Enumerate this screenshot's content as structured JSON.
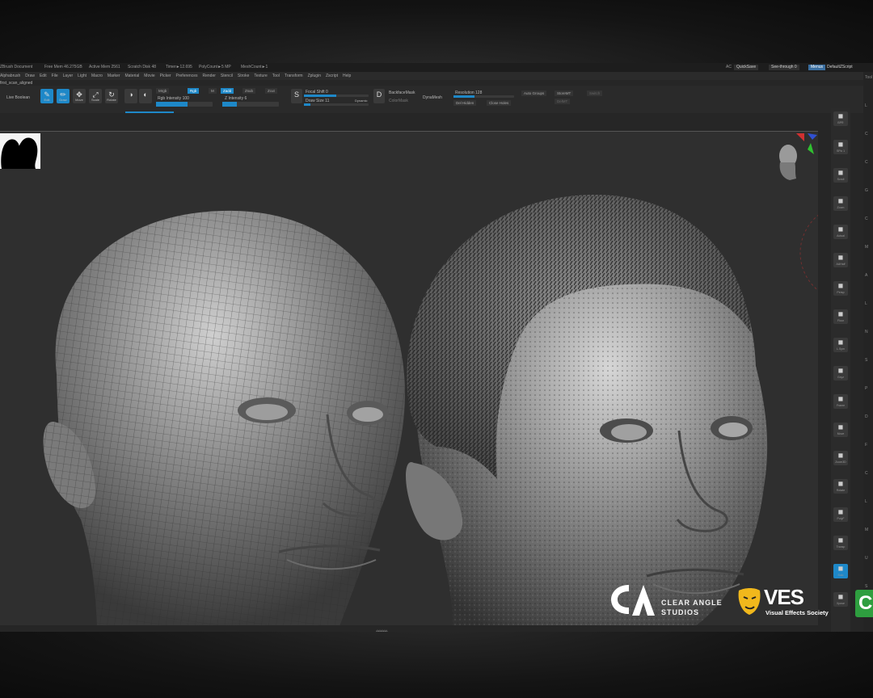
{
  "titlebar": {
    "doc": "ZBrush Document",
    "free_mem": "Free Mem 46.275GB",
    "active_mem": "Active Mem 2561",
    "scratch": "Scratch Disk 48",
    "timer": "Timer►12.695",
    "poly_count": "PolyCount►5 MP",
    "mesh_count": "MeshCount►1",
    "ac": "AC",
    "quicksave": "QuickSave",
    "see_through": "See-through  0",
    "menus_btn": "Menus",
    "script": "DefaultZScript"
  },
  "menubar": [
    "Alphabrush",
    "Draw",
    "Edit",
    "File",
    "Layer",
    "Light",
    "Macro",
    "Marker",
    "Material",
    "Movie",
    "Picker",
    "Preferences",
    "Render",
    "Stencil",
    "Stroke",
    "Texture",
    "Tool",
    "Transform",
    "Zplugin",
    "Zscript",
    "Help"
  ],
  "doc_label": "first_scan_aligned",
  "toolbar": {
    "live_boolean": "Live Boolean",
    "tools": [
      {
        "label": "Edit",
        "icon": "edit-icon",
        "glyph": "✎",
        "active": true
      },
      {
        "label": "Draw",
        "icon": "draw-icon",
        "glyph": "✏",
        "active": true
      },
      {
        "label": "Move",
        "icon": "move-icon",
        "glyph": "✥",
        "active": false
      },
      {
        "label": "Scale",
        "icon": "scale-icon",
        "glyph": "⤢",
        "active": false
      },
      {
        "label": "Rotate",
        "icon": "rotate-icon",
        "glyph": "↻",
        "active": false
      }
    ],
    "mrgb": "Mrgb",
    "rgb": "Rgb",
    "m": "M",
    "zadd": "Zadd",
    "zsub": "Zsub",
    "zcut": "Zcut",
    "rgb_intensity": "Rgb Intensity 100",
    "z_intensity": "Z Intensity 6",
    "focal_shift": "Focal Shift 0",
    "draw_size": "Draw Size 11",
    "dynamic": "Dynamic",
    "backface_mask": "BackfaceMask",
    "color_mask": "ColorMask",
    "dynamesh": "DynaMesh",
    "resolution": "Resolution 128",
    "del_hidden": "Del Hidden",
    "close_holes": "Close Holes",
    "auto_groups": "Auto Groups",
    "store_mt": "StoreMT",
    "switch": "Switch",
    "del_mt": "DelMT"
  },
  "levels": {
    "rgb_intensity": 0.55,
    "z_intensity": 0.25,
    "focal_shift": 0.5,
    "draw_size": 0.1,
    "resolution": 0.35
  },
  "right_tools": [
    {
      "icon": "sphere-icon",
      "label": "BPR"
    },
    {
      "icon": "spix-icon",
      "label": "SPix 1"
    },
    {
      "icon": "scroll-icon",
      "label": "Scroll"
    },
    {
      "icon": "zoom-icon",
      "label": "Zoom"
    },
    {
      "icon": "actual-icon",
      "label": "Actual"
    },
    {
      "icon": "aahalf-icon",
      "label": "AAHalf"
    },
    {
      "icon": "persp-icon",
      "label": "Persp"
    },
    {
      "icon": "floor-icon",
      "label": "Floor"
    },
    {
      "icon": "lsym-icon",
      "label": "L.Sym"
    },
    {
      "icon": "xyz-icon",
      "label": "Gxyz"
    },
    {
      "icon": "frame-icon",
      "label": "Frame"
    },
    {
      "icon": "move-icon",
      "label": "Move"
    },
    {
      "icon": "zoom3d-icon",
      "label": "Zoom3D"
    },
    {
      "icon": "rotate-icon",
      "label": "Rotate"
    },
    {
      "icon": "polyf-icon",
      "label": "PolyF"
    },
    {
      "icon": "transp-icon",
      "label": "Transp"
    },
    {
      "icon": "solo-icon",
      "label": "Solo"
    },
    {
      "icon": "xpose-icon",
      "label": "Xpose"
    }
  ],
  "far_right_labels": [
    "Tool",
    "L",
    "C",
    "C",
    "G",
    "C",
    "M",
    "A",
    "L",
    "N",
    "S",
    "P",
    "D",
    "F",
    "C",
    "L",
    "M",
    "U",
    "S"
  ],
  "logos": {
    "ca_line1": "CLEAR ANGLE",
    "ca_line2": "STUDIOS",
    "ves_title": "VES",
    "ves_sub": "Visual Effects Society",
    "green_letter": "C"
  },
  "colors": {
    "accent": "#1e88c8",
    "panel": "#2a2a2a",
    "canvas": "#2f2f2f"
  }
}
